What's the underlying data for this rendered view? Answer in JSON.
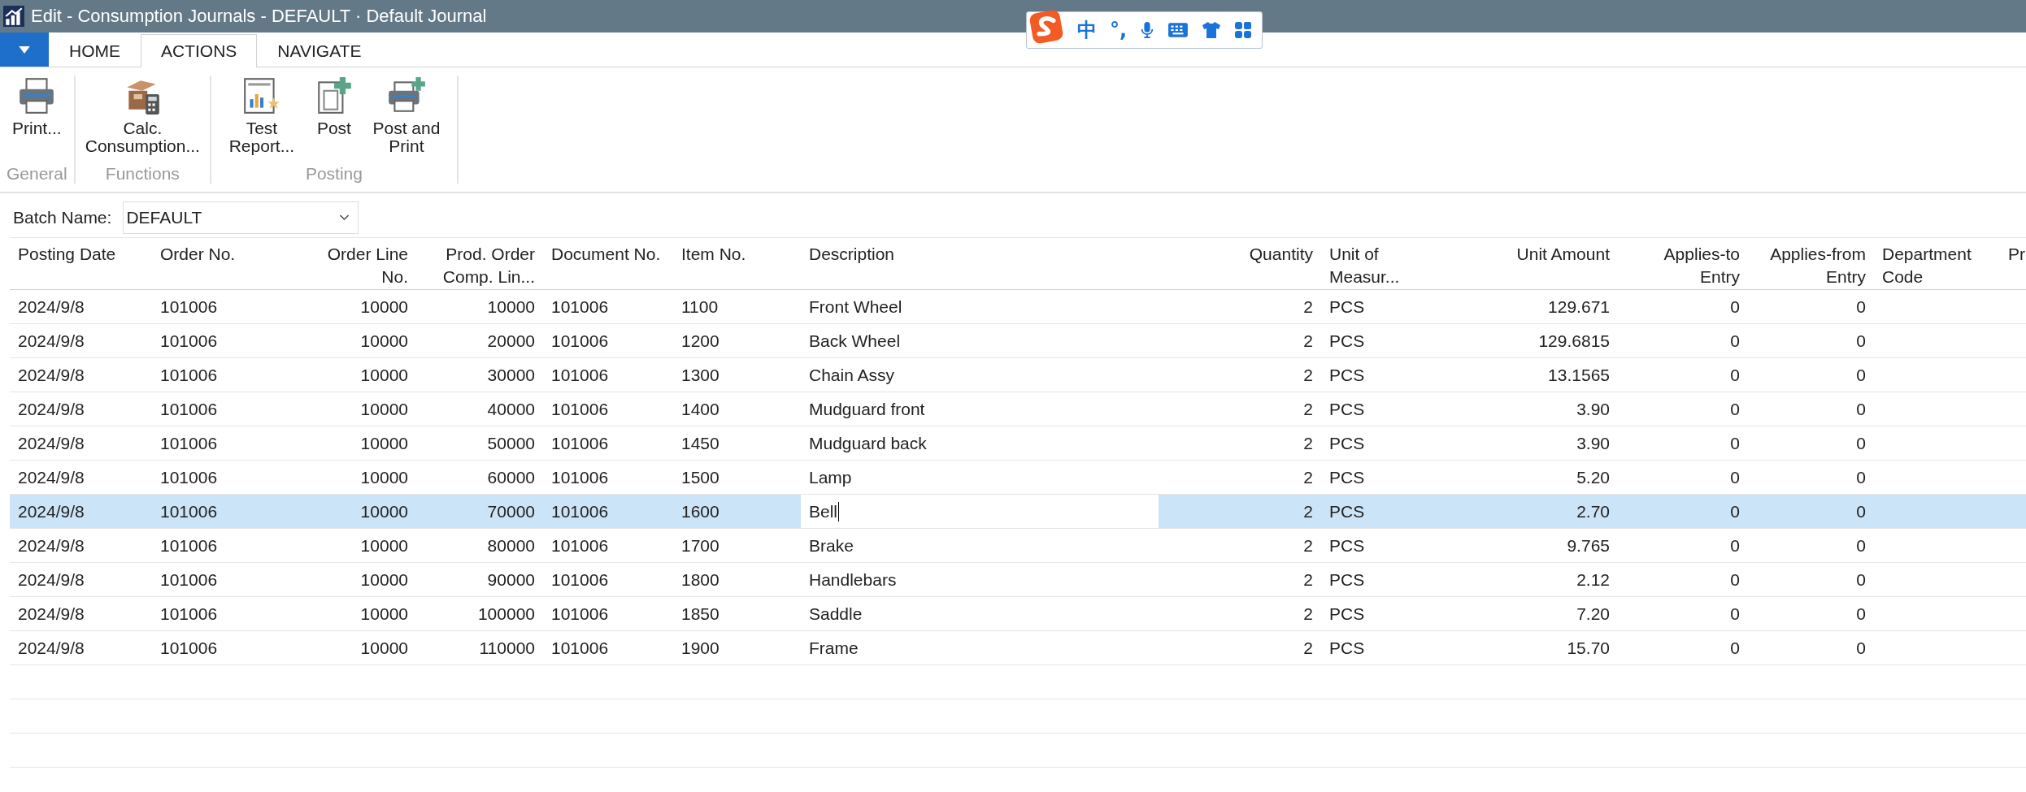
{
  "window": {
    "title": "Edit - Consumption Journals - DEFAULT · Default Journal"
  },
  "ime_toolbar": {
    "items": [
      "中",
      "°,"
    ]
  },
  "tabs": [
    {
      "label": "HOME",
      "selected": false
    },
    {
      "label": "ACTIONS",
      "selected": true
    },
    {
      "label": "NAVIGATE",
      "selected": false
    }
  ],
  "ribbon": {
    "groups": [
      {
        "label": "General",
        "actions": [
          {
            "kind": "print",
            "label": "Print..."
          }
        ]
      },
      {
        "label": "Functions",
        "actions": [
          {
            "kind": "calc",
            "label": "Calc. Consumption..."
          }
        ]
      },
      {
        "label": "Posting",
        "actions": [
          {
            "kind": "report",
            "label": "Test Report..."
          },
          {
            "kind": "post",
            "label": "Post"
          },
          {
            "kind": "postprint",
            "label": "Post and Print"
          }
        ]
      }
    ]
  },
  "batch": {
    "label": "Batch Name:",
    "value": "DEFAULT"
  },
  "table": {
    "columns": [
      "Posting Date",
      "Order No.",
      "Order Line No.",
      "Prod. Order Comp. Lin...",
      "Document No.",
      "Item No.",
      "Description",
      "Quantity",
      "Unit of Measur...",
      "Unit Amount",
      "Applies-to Entry",
      "Applies-from Entry",
      "Department Code",
      "Pr"
    ],
    "rows": [
      {
        "selected": false,
        "editing": false,
        "cells": [
          "2024/9/8",
          "101006",
          "10000",
          "10000",
          "101006",
          "1100",
          "Front Wheel",
          "2",
          "PCS",
          "129.671",
          "0",
          "0"
        ]
      },
      {
        "selected": false,
        "editing": false,
        "cells": [
          "2024/9/8",
          "101006",
          "10000",
          "20000",
          "101006",
          "1200",
          "Back Wheel",
          "2",
          "PCS",
          "129.6815",
          "0",
          "0"
        ]
      },
      {
        "selected": false,
        "editing": false,
        "cells": [
          "2024/9/8",
          "101006",
          "10000",
          "30000",
          "101006",
          "1300",
          "Chain Assy",
          "2",
          "PCS",
          "13.1565",
          "0",
          "0"
        ]
      },
      {
        "selected": false,
        "editing": false,
        "cells": [
          "2024/9/8",
          "101006",
          "10000",
          "40000",
          "101006",
          "1400",
          "Mudguard front",
          "2",
          "PCS",
          "3.90",
          "0",
          "0"
        ]
      },
      {
        "selected": false,
        "editing": false,
        "cells": [
          "2024/9/8",
          "101006",
          "10000",
          "50000",
          "101006",
          "1450",
          "Mudguard back",
          "2",
          "PCS",
          "3.90",
          "0",
          "0"
        ]
      },
      {
        "selected": false,
        "editing": false,
        "cells": [
          "2024/9/8",
          "101006",
          "10000",
          "60000",
          "101006",
          "1500",
          "Lamp",
          "2",
          "PCS",
          "5.20",
          "0",
          "0"
        ]
      },
      {
        "selected": true,
        "editing": true,
        "cells": [
          "2024/9/8",
          "101006",
          "10000",
          "70000",
          "101006",
          "1600",
          "Bell",
          "2",
          "PCS",
          "2.70",
          "0",
          "0"
        ]
      },
      {
        "selected": false,
        "editing": false,
        "cells": [
          "2024/9/8",
          "101006",
          "10000",
          "80000",
          "101006",
          "1700",
          "Brake",
          "2",
          "PCS",
          "9.765",
          "0",
          "0"
        ]
      },
      {
        "selected": false,
        "editing": false,
        "cells": [
          "2024/9/8",
          "101006",
          "10000",
          "90000",
          "101006",
          "1800",
          "Handlebars",
          "2",
          "PCS",
          "2.12",
          "0",
          "0"
        ]
      },
      {
        "selected": false,
        "editing": false,
        "cells": [
          "2024/9/8",
          "101006",
          "10000",
          "100000",
          "101006",
          "1850",
          "Saddle",
          "2",
          "PCS",
          "7.20",
          "0",
          "0"
        ]
      },
      {
        "selected": false,
        "editing": false,
        "cells": [
          "2024/9/8",
          "101006",
          "10000",
          "110000",
          "101006",
          "1900",
          "Frame",
          "2",
          "PCS",
          "15.70",
          "0",
          "0"
        ]
      }
    ]
  }
}
